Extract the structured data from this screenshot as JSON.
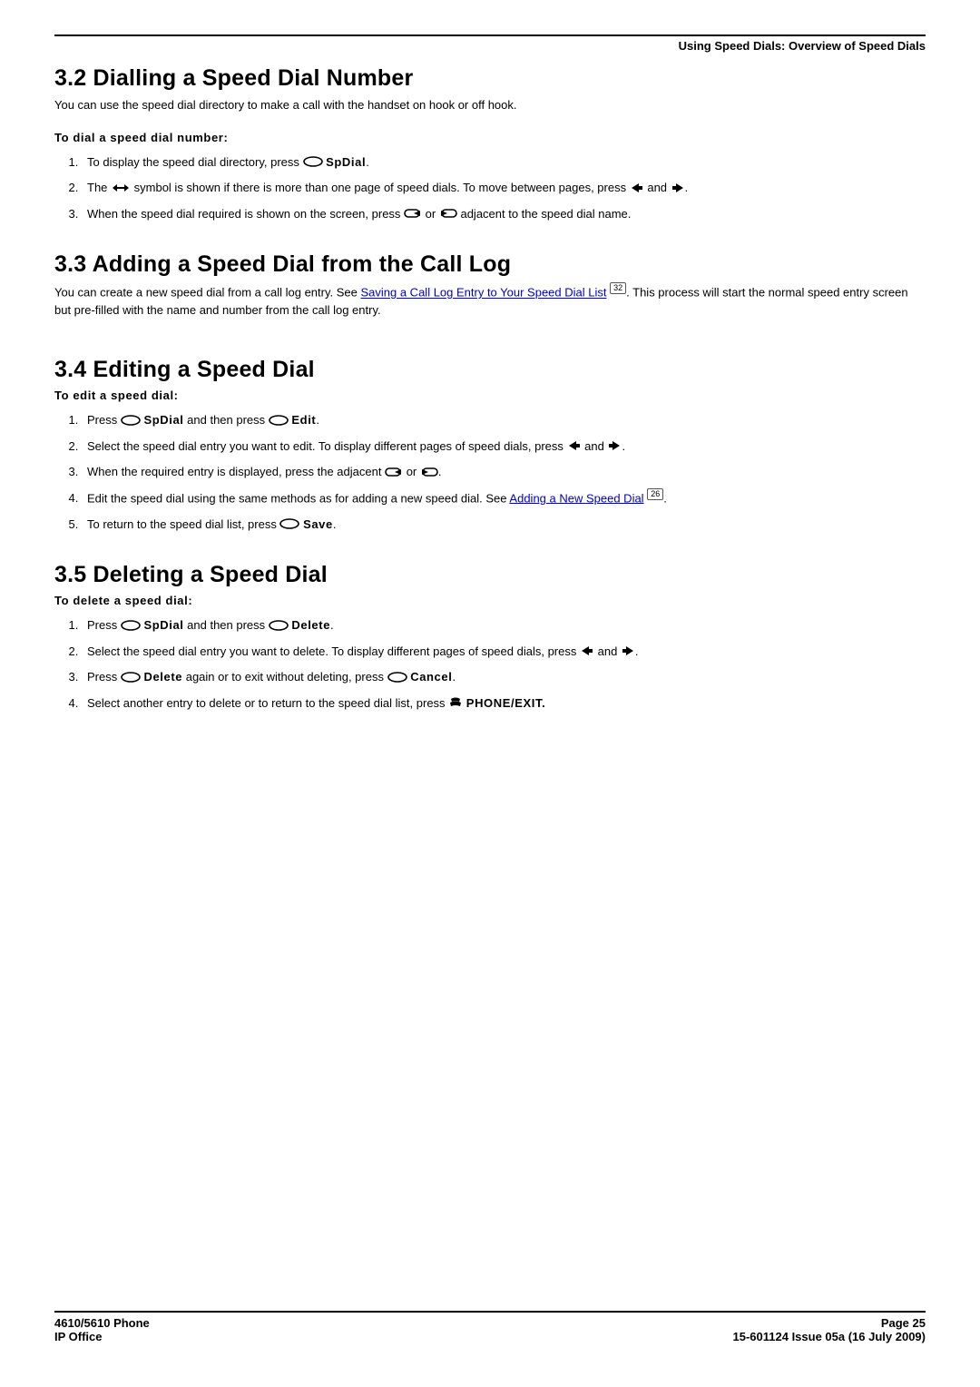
{
  "header": {
    "breadcrumb": "Using Speed Dials: Overview of Speed Dials"
  },
  "sections": {
    "s32": {
      "title": "3.2 Dialling a Speed Dial Number",
      "intro": "You can use the speed dial directory to make a call with the handset on hook or off hook.",
      "lead": "To dial a speed dial number:",
      "steps": {
        "1a": "To display the speed dial directory, press ",
        "1b": "SpDial",
        "1c": ".",
        "2a": "The ",
        "2b": " symbol is shown if there is more than one page of speed dials. To move between pages, press ",
        "2c": " and ",
        "2d": ".",
        "3a": "When the speed dial required is shown on the screen, press ",
        "3b": " or ",
        "3c": " adjacent to the speed dial name."
      }
    },
    "s33": {
      "title": "3.3 Adding a Speed Dial from the Call Log",
      "p_a": "You can create a new speed dial from a call log entry. See ",
      "link": "Saving a Call Log Entry to Your Speed Dial List",
      "pageref": "32",
      "p_b": ". This process will start the normal speed entry screen but pre-filled with the name and number from the call log entry."
    },
    "s34": {
      "title": "3.4 Editing a Speed Dial",
      "lead": "To edit a speed dial:",
      "steps": {
        "1a": "Press ",
        "1b": "SpDial",
        "1c": " and then press ",
        "1d": "Edit",
        "1e": ".",
        "2a": "Select the speed dial entry you want to edit. To display different pages of speed dials, press ",
        "2b": " and ",
        "2c": ".",
        "3a": "When the required entry is displayed, press the adjacent ",
        "3b": " or ",
        "3c": ".",
        "4a": "Edit the speed dial using the same methods as for adding a new speed dial. See ",
        "4link": "Adding a New Speed Dial",
        "4pageref": "26",
        "4b": ".",
        "5a": "To return to the speed dial list, press ",
        "5b": "Save",
        "5c": "."
      }
    },
    "s35": {
      "title": "3.5 Deleting a Speed Dial",
      "lead": "To delete a speed dial:",
      "steps": {
        "1a": "Press ",
        "1b": "SpDial",
        "1c": " and then press ",
        "1d": "Delete",
        "1e": ".",
        "2a": "Select the speed dial entry you want to delete. To display different pages of speed dials, press ",
        "2b": " and ",
        "2c": ".",
        "3a": "Press ",
        "3b": "Delete",
        "3c": " again or to exit without deleting, press ",
        "3d": "Cancel",
        "3e": ".",
        "4a": "Select another entry to delete or to return to the speed dial list, press ",
        "4b": " PHONE/EXIT."
      }
    }
  },
  "footer": {
    "left1": "4610/5610 Phone",
    "left2": "IP Office",
    "right1": "Page 25",
    "right2": "15-601124 Issue 05a (16 July 2009)"
  }
}
